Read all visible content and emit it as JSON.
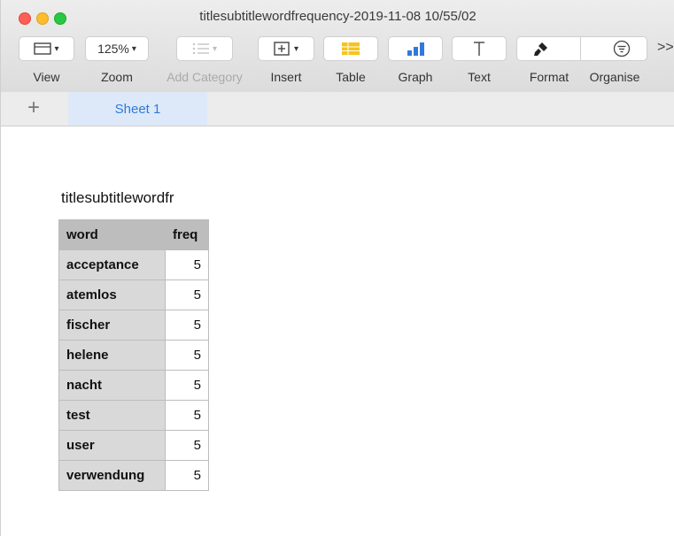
{
  "window": {
    "title": "titlesubtitlewordfrequency-2019-11-08 10/55/02"
  },
  "toolbar": {
    "view": "View",
    "zoom_value": "125%",
    "zoom": "Zoom",
    "add_category": "Add Category",
    "insert": "Insert",
    "table": "Table",
    "graph": "Graph",
    "text": "Text",
    "format": "Format",
    "organise": "Organise",
    "overflow": ">>"
  },
  "tabs": {
    "add": "+",
    "sheet": "Sheet 1"
  },
  "table": {
    "title": "titlesubtitlewordfr",
    "headers": [
      "word",
      "freq"
    ],
    "rows": [
      {
        "word": "acceptance",
        "freq": "5"
      },
      {
        "word": "atemlos",
        "freq": "5"
      },
      {
        "word": "fischer",
        "freq": "5"
      },
      {
        "word": "helene",
        "freq": "5"
      },
      {
        "word": "nacht",
        "freq": "5"
      },
      {
        "word": "test",
        "freq": "5"
      },
      {
        "word": "user",
        "freq": "5"
      },
      {
        "word": "verwendung",
        "freq": "5"
      }
    ]
  },
  "colors": {
    "accent": "#2f7ad9",
    "table_icon": "#f5c518",
    "graph_icon": "#2f7ad9"
  }
}
